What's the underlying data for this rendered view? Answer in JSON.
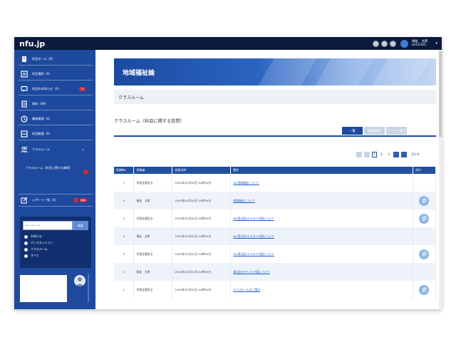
{
  "app": {
    "logo": "nfu.jp"
  },
  "header": {
    "user_name": "福祉　太郎",
    "user_id": "ee12345"
  },
  "sidebar": {
    "items": [
      {
        "label": "科目ホーム（6）",
        "icon": "home-icon",
        "badge": ""
      },
      {
        "label": "科目選択（6）",
        "icon": "list-icon",
        "badge": ""
      },
      {
        "label": "科目のお知らせ（4）",
        "icon": "chat-icon",
        "badge": "33"
      },
      {
        "label": "資料（89）",
        "icon": "document-icon",
        "badge": ""
      },
      {
        "label": "履修概要（6）",
        "icon": "clock-icon",
        "badge": ""
      },
      {
        "label": "科目概要（6）",
        "icon": "grid-icon",
        "badge": ""
      },
      {
        "label": "クラスルーム",
        "icon": "users-icon",
        "badge": ""
      }
    ],
    "sub_item": {
      "label": "クラスルーム（科目に関する質問）"
    },
    "report": {
      "label": "レポート一覧（4）",
      "badge": "新着4"
    },
    "search": {
      "placeholder": "キーワード",
      "button": "検索",
      "options": [
        "お知らせ",
        "ディスカッション",
        "クラスルーム",
        "すべて"
      ]
    }
  },
  "main": {
    "banner_title": "地域福祉論",
    "page_head": "クラスルーム",
    "section_title": "クラスルーム（科目に関する質問）",
    "tabs": [
      {
        "label": "一覧",
        "active": true
      },
      {
        "label": "新規投稿",
        "active": false
      },
      {
        "label": "スレッド表示",
        "active": false
      }
    ],
    "pager": {
      "pages": [
        "1",
        "2",
        "3"
      ],
      "current": "1",
      "count": "1/3 件"
    },
    "table": {
      "headers": [
        "投稿No.",
        "投稿者",
        "投稿日時",
        "題名",
        "添付"
      ],
      "rows": [
        {
          "no": "7",
          "author": "学習支援担当",
          "date": "20XX年XX月XX日 XX時XX分",
          "title": "Re:地域福祉について",
          "attach": false
        },
        {
          "no": "5",
          "author": "福祉　太郎",
          "date": "20XX年XX月XX日 XX時XX分",
          "title": "地域福祉について",
          "attach": true
        },
        {
          "no": "5",
          "author": "学習支援担当",
          "date": "20XX年XX月XX日 XX時XX分",
          "title": "Re:第4回のテキスト内容について",
          "attach": true
        },
        {
          "no": "4",
          "author": "福祉　太郎",
          "date": "20XX年XX月XX日 XX時XX分",
          "title": "Re:第4回のテキスト内容について",
          "attach": false
        },
        {
          "no": "3",
          "author": "学習支援担当",
          "date": "20XX年XX月XX日 XX時XX分",
          "title": "Re:第4回のテキスト内容について",
          "attach": true
        },
        {
          "no": "2",
          "author": "福祉　太郎",
          "date": "20XX年XX月XX日 XX時XX分",
          "title": "第4回のテキスト内容について",
          "attach": false
        },
        {
          "no": "1",
          "author": "学習支援担当",
          "date": "20XX年XX月XX日 XX時XX分",
          "title": "クラスルームのご案内",
          "attach": true
        }
      ]
    }
  },
  "colors": {
    "sidebar": "#1d4a9e",
    "topbar": "#0b1a3c",
    "accent": "#1f4f9e",
    "badge": "#d9262f"
  }
}
